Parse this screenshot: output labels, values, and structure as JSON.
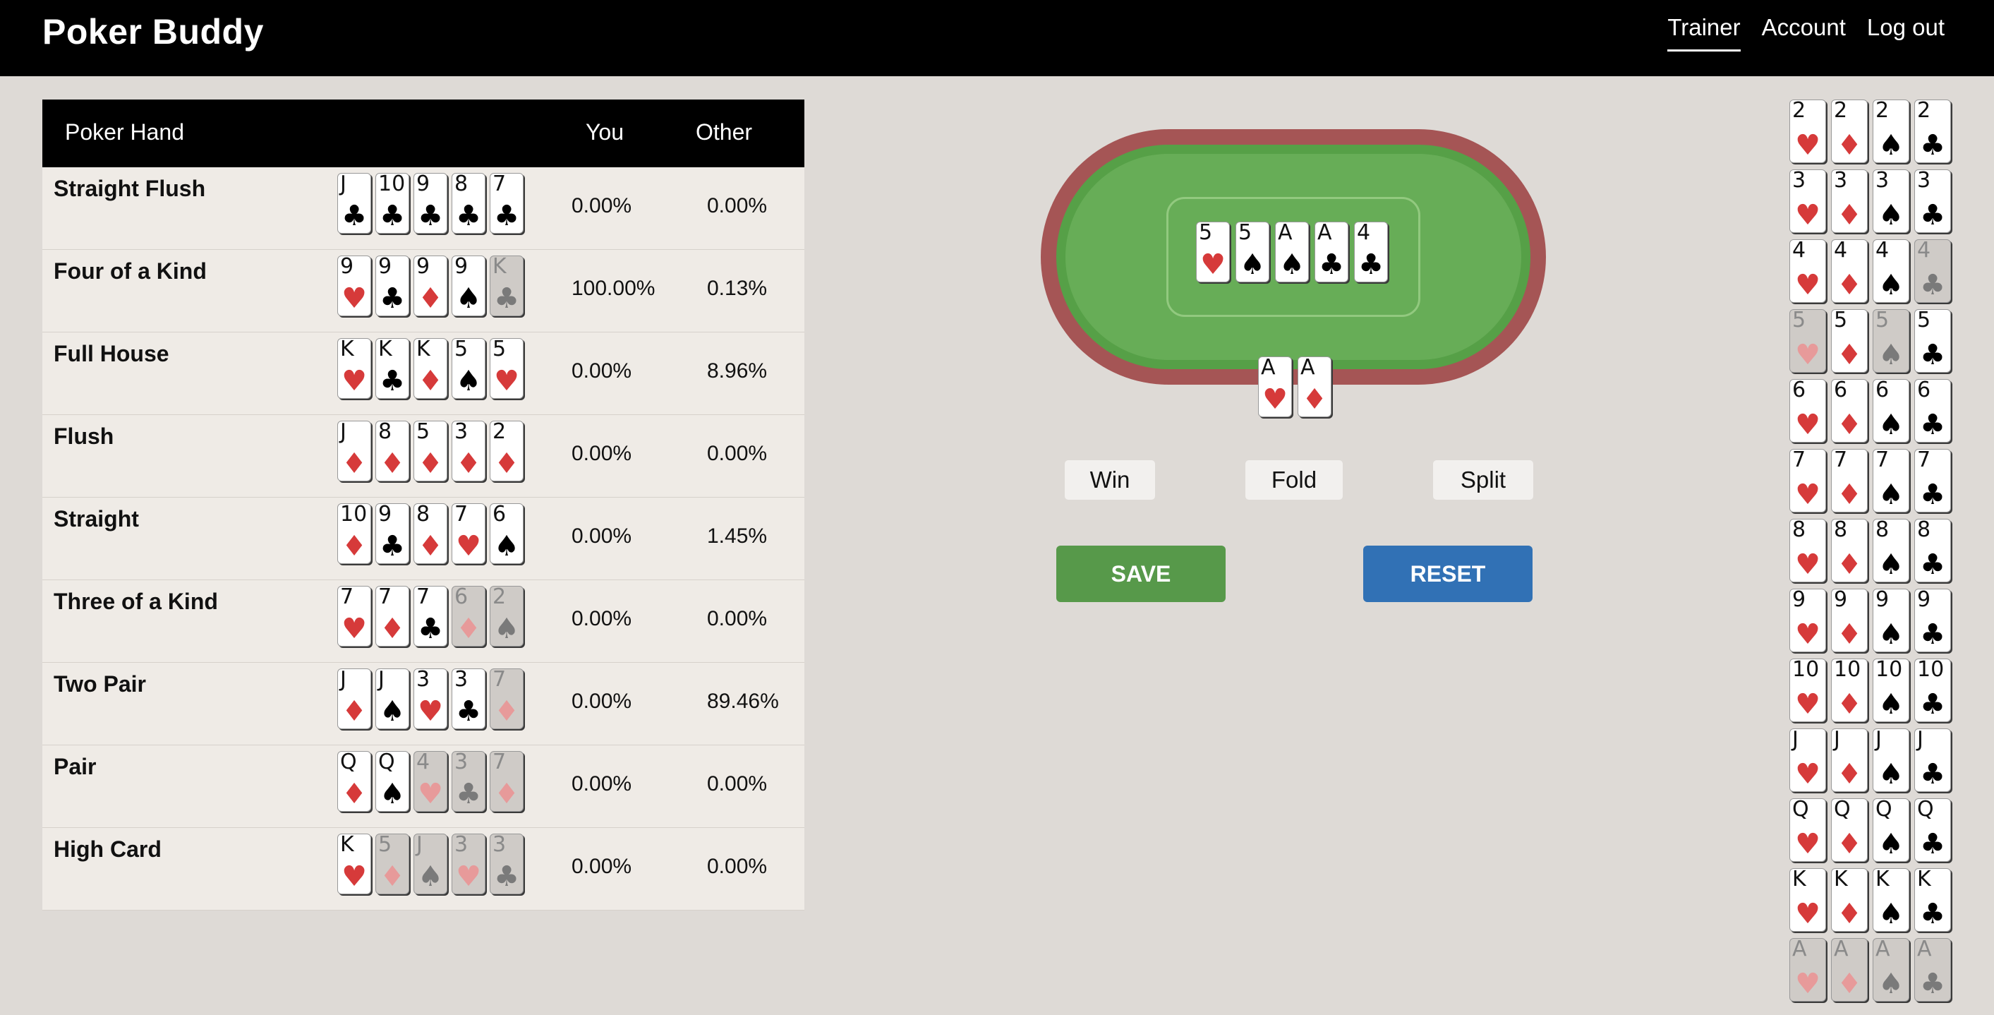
{
  "brand": "Poker Buddy",
  "nav": [
    {
      "label": "Trainer",
      "active": true
    },
    {
      "label": "Account",
      "active": false
    },
    {
      "label": "Log out",
      "active": false
    }
  ],
  "hands_table": {
    "headers": {
      "hand": "Poker Hand",
      "you": "You",
      "other": "Other"
    },
    "rows": [
      {
        "name": "Straight Flush",
        "you": "0.00%",
        "other": "0.00%",
        "cards": [
          {
            "rank": "J",
            "suit": "♣",
            "dim": false
          },
          {
            "rank": "10",
            "suit": "♣",
            "dim": false
          },
          {
            "rank": "9",
            "suit": "♣",
            "dim": false
          },
          {
            "rank": "8",
            "suit": "♣",
            "dim": false
          },
          {
            "rank": "7",
            "suit": "♣",
            "dim": false
          }
        ]
      },
      {
        "name": "Four of a Kind",
        "you": "100.00%",
        "other": "0.13%",
        "cards": [
          {
            "rank": "9",
            "suit": "♥",
            "dim": false
          },
          {
            "rank": "9",
            "suit": "♣",
            "dim": false
          },
          {
            "rank": "9",
            "suit": "♦",
            "dim": false
          },
          {
            "rank": "9",
            "suit": "♠",
            "dim": false
          },
          {
            "rank": "K",
            "suit": "♣",
            "dim": true
          }
        ]
      },
      {
        "name": "Full House",
        "you": "0.00%",
        "other": "8.96%",
        "cards": [
          {
            "rank": "K",
            "suit": "♥",
            "dim": false
          },
          {
            "rank": "K",
            "suit": "♣",
            "dim": false
          },
          {
            "rank": "K",
            "suit": "♦",
            "dim": false
          },
          {
            "rank": "5",
            "suit": "♠",
            "dim": false
          },
          {
            "rank": "5",
            "suit": "♥",
            "dim": false
          }
        ]
      },
      {
        "name": "Flush",
        "you": "0.00%",
        "other": "0.00%",
        "cards": [
          {
            "rank": "J",
            "suit": "♦",
            "dim": false
          },
          {
            "rank": "8",
            "suit": "♦",
            "dim": false
          },
          {
            "rank": "5",
            "suit": "♦",
            "dim": false
          },
          {
            "rank": "3",
            "suit": "♦",
            "dim": false
          },
          {
            "rank": "2",
            "suit": "♦",
            "dim": false
          }
        ]
      },
      {
        "name": "Straight",
        "you": "0.00%",
        "other": "1.45%",
        "cards": [
          {
            "rank": "10",
            "suit": "♦",
            "dim": false
          },
          {
            "rank": "9",
            "suit": "♣",
            "dim": false
          },
          {
            "rank": "8",
            "suit": "♦",
            "dim": false
          },
          {
            "rank": "7",
            "suit": "♥",
            "dim": false
          },
          {
            "rank": "6",
            "suit": "♠",
            "dim": false
          }
        ]
      },
      {
        "name": "Three of a Kind",
        "you": "0.00%",
        "other": "0.00%",
        "cards": [
          {
            "rank": "7",
            "suit": "♥",
            "dim": false
          },
          {
            "rank": "7",
            "suit": "♦",
            "dim": false
          },
          {
            "rank": "7",
            "suit": "♣",
            "dim": false
          },
          {
            "rank": "6",
            "suit": "♦",
            "dim": true
          },
          {
            "rank": "2",
            "suit": "♠",
            "dim": true
          }
        ]
      },
      {
        "name": "Two Pair",
        "you": "0.00%",
        "other": "89.46%",
        "cards": [
          {
            "rank": "J",
            "suit": "♦",
            "dim": false
          },
          {
            "rank": "J",
            "suit": "♠",
            "dim": false
          },
          {
            "rank": "3",
            "suit": "♥",
            "dim": false
          },
          {
            "rank": "3",
            "suit": "♣",
            "dim": false
          },
          {
            "rank": "7",
            "suit": "♦",
            "dim": true
          }
        ]
      },
      {
        "name": "Pair",
        "you": "0.00%",
        "other": "0.00%",
        "cards": [
          {
            "rank": "Q",
            "suit": "♦",
            "dim": false
          },
          {
            "rank": "Q",
            "suit": "♠",
            "dim": false
          },
          {
            "rank": "4",
            "suit": "♥",
            "dim": true
          },
          {
            "rank": "3",
            "suit": "♣",
            "dim": true
          },
          {
            "rank": "7",
            "suit": "♦",
            "dim": true
          }
        ]
      },
      {
        "name": "High Card",
        "you": "0.00%",
        "other": "0.00%",
        "cards": [
          {
            "rank": "K",
            "suit": "♥",
            "dim": false
          },
          {
            "rank": "5",
            "suit": "♦",
            "dim": true
          },
          {
            "rank": "J",
            "suit": "♠",
            "dim": true
          },
          {
            "rank": "3",
            "suit": "♥",
            "dim": true
          },
          {
            "rank": "3",
            "suit": "♣",
            "dim": true
          }
        ]
      }
    ]
  },
  "board_cards": [
    {
      "rank": "5",
      "suit": "♥"
    },
    {
      "rank": "5",
      "suit": "♠"
    },
    {
      "rank": "A",
      "suit": "♠"
    },
    {
      "rank": "A",
      "suit": "♣"
    },
    {
      "rank": "4",
      "suit": "♣"
    }
  ],
  "hole_cards": [
    {
      "rank": "A",
      "suit": "♥"
    },
    {
      "rank": "A",
      "suit": "♦"
    }
  ],
  "actions": {
    "win": "Win",
    "fold": "Fold",
    "split": "Split",
    "save": "SAVE",
    "reset": "RESET"
  },
  "deck": {
    "suits": [
      "♥",
      "♦",
      "♠",
      "♣"
    ],
    "ranks": [
      "2",
      "3",
      "4",
      "5",
      "6",
      "7",
      "8",
      "9",
      "10",
      "J",
      "Q",
      "K",
      "A"
    ],
    "used": [
      "4♣",
      "5♥",
      "5♠",
      "A♥",
      "A♦",
      "A♠",
      "A♣"
    ]
  },
  "colors": {
    "red_suit": "#d63a3a",
    "black_suit": "#000000",
    "save": "#57994a",
    "reset": "#3171b5",
    "felt": "#67ad57",
    "rail": "#a55555"
  }
}
